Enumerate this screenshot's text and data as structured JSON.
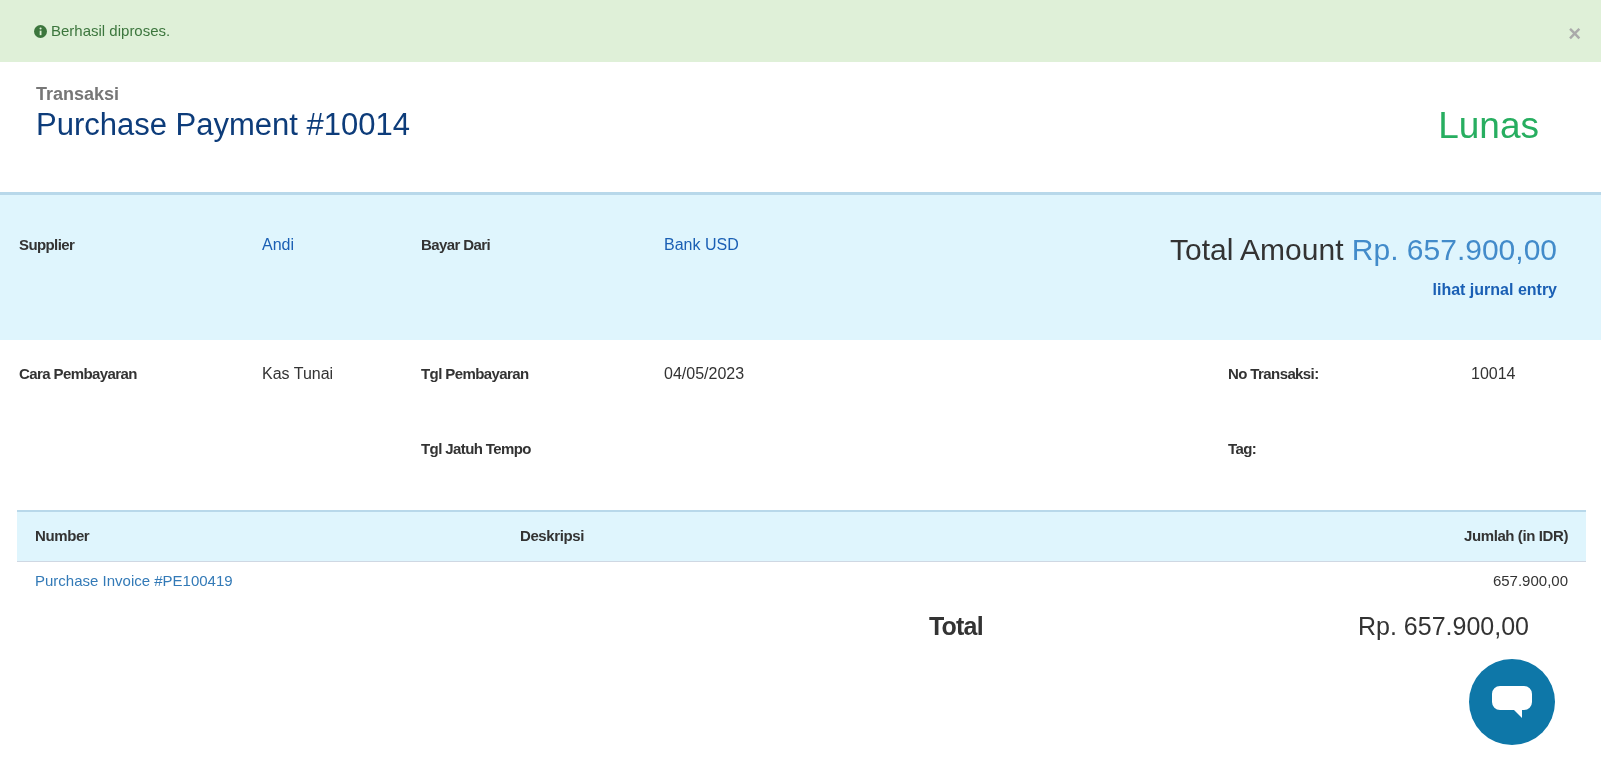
{
  "alert": {
    "message": "Berhasil diproses.",
    "close": "×"
  },
  "header": {
    "subtitle": "Transaksi",
    "title": "Purchase Payment #10014",
    "status": "Lunas"
  },
  "summary": {
    "fields": [
      {
        "label": "Supplier",
        "value": "Andi"
      },
      {
        "label": "Bayar Dari",
        "value": "Bank USD"
      }
    ],
    "total_label": "Total Amount",
    "total_value": "Rp. 657.900,00",
    "journal_link": "lihat jurnal entry"
  },
  "details": [
    {
      "fields": [
        {
          "label": "Cara Pembayaran",
          "value": "Kas Tunai"
        }
      ]
    },
    {
      "fields": [
        {
          "label": "Tgl Pembayaran",
          "value": "04/05/2023"
        },
        {
          "label": "Tgl Jatuh Tempo"
        }
      ]
    },
    {
      "fields": [
        {
          "label": "No Transaksi:",
          "value": "10014"
        },
        {
          "label": "Tag:"
        }
      ]
    }
  ],
  "table": {
    "columns": [
      "Number",
      "Deskripsi",
      "Jumlah (in IDR)"
    ],
    "rows": [
      {
        "number": "Purchase Invoice #PE100419",
        "amount": "657.900,00"
      }
    ],
    "total_label": "Total",
    "total_value": "Rp. 657.900,00"
  }
}
